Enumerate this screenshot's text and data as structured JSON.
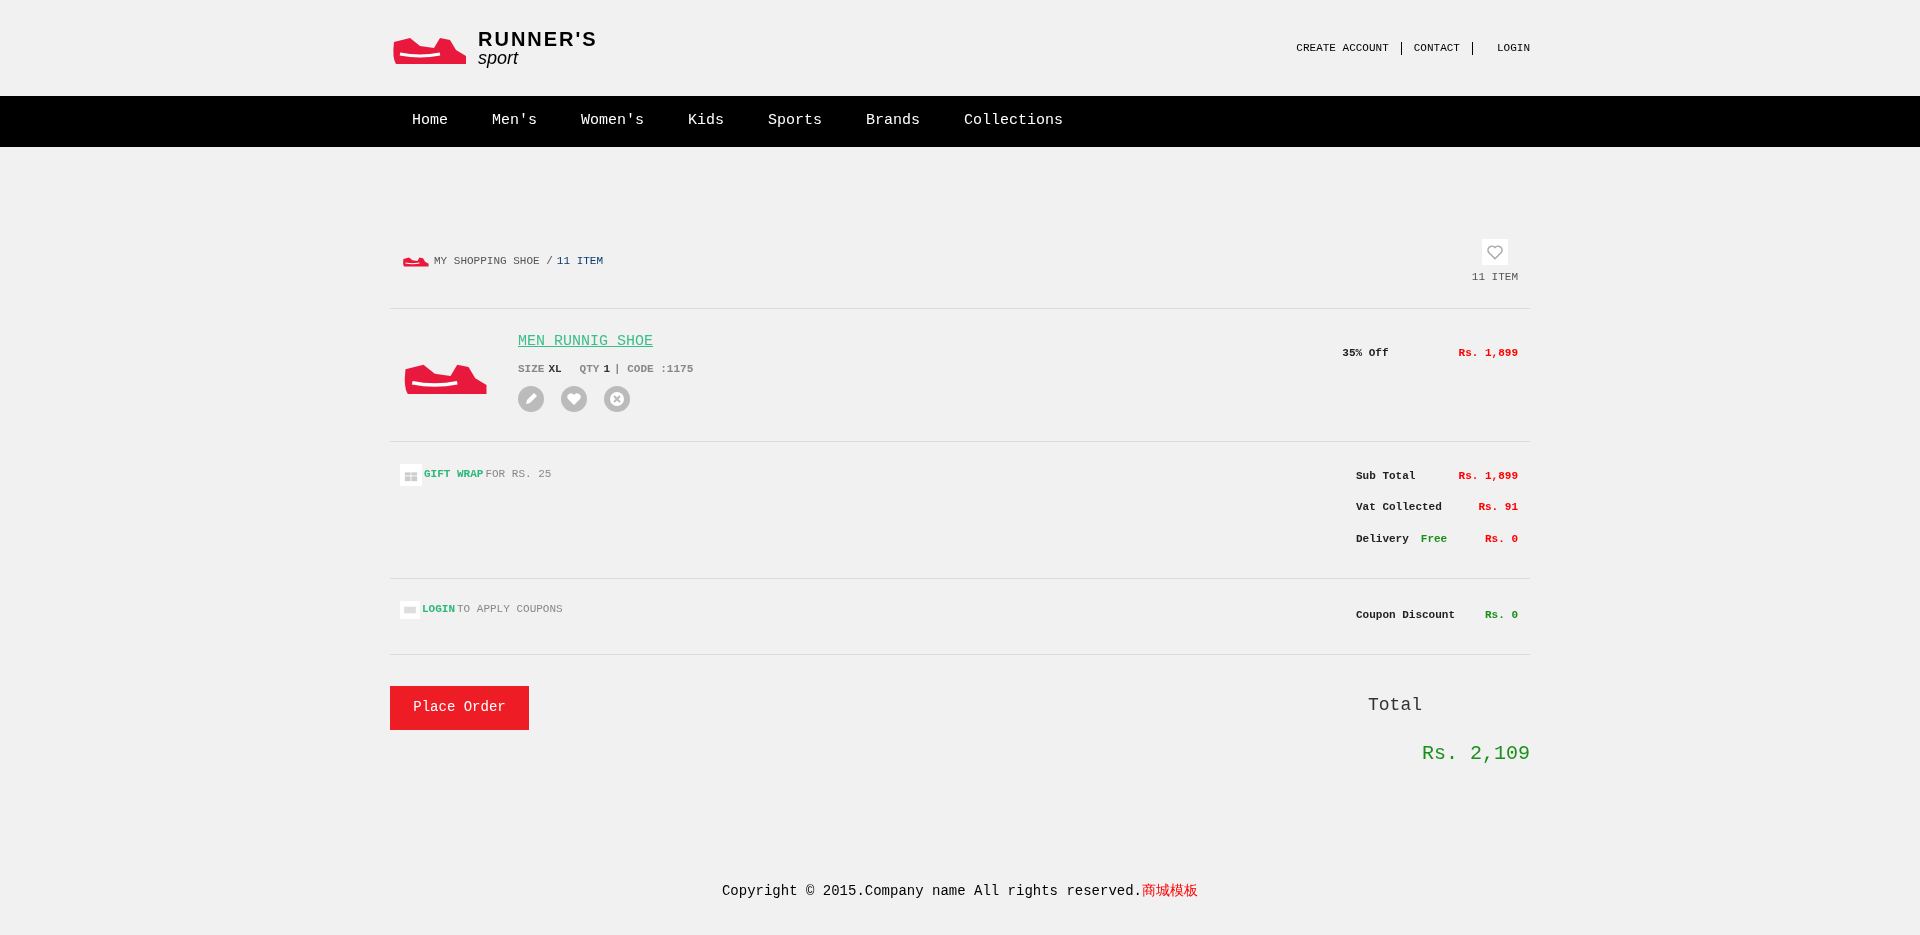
{
  "logo": {
    "title": "RUNNER'S",
    "subtitle": "sport"
  },
  "top_links": [
    "CREATE ACCOUNT",
    "CONTACT",
    "LOGIN"
  ],
  "nav": [
    "Home",
    "Men's",
    "Women's",
    "Kids",
    "Sports",
    "Brands",
    "Collections"
  ],
  "cart_header": {
    "label": "MY SHOPPING SHOE /",
    "count": "11 ITEM",
    "wishlist_count": "11 ITEM"
  },
  "item": {
    "name": "MEN RUNNIG SHOE",
    "size_label": "SIZE",
    "size": "XL",
    "qty_label": "QTY",
    "qty": "1",
    "code": "| CODE :1175",
    "discount": "35% Off",
    "price": "Rs. 1,899"
  },
  "gift_wrap": {
    "link": "GIFT WRAP",
    "text": "FOR RS. 25"
  },
  "summary": [
    {
      "label": "Sub Total",
      "value": "Rs. 1,899"
    },
    {
      "label": "Vat Collected",
      "value": "Rs. 91"
    },
    {
      "label": "Delivery",
      "note": "Free",
      "value": "Rs. 0"
    }
  ],
  "coupon": {
    "link": "LOGIN",
    "text": "TO APPLY COUPONS",
    "label": "Coupon Discount",
    "value": "Rs. 0"
  },
  "place_order": "Place Order",
  "total": {
    "label": "Total",
    "value": "Rs. 2,109"
  },
  "footer": {
    "text": "Copyright © 2015.Company name All rights reserved.",
    "link": "商城模板"
  }
}
